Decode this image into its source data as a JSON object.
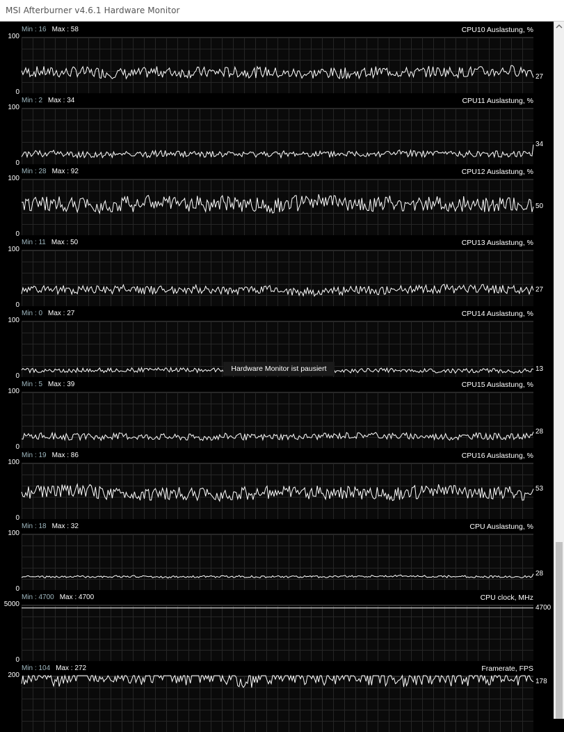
{
  "window": {
    "title": "MSI Afterburner v4.6.1 Hardware Monitor"
  },
  "status": {
    "paused": "Hardware Monitor ist pausiert"
  },
  "colors": {
    "background": "#000000",
    "trace": "#ffffff",
    "grid": "#262626",
    "min_label": "#9fb8c0"
  },
  "graphs": [
    {
      "title": "CPU10 Auslastung, %",
      "min_label": "Min : 16",
      "max_label": "Max : 58",
      "ymax": "100",
      "ymin": "0",
      "current": "27",
      "min": 16,
      "max": 58,
      "avg": 38,
      "noise": 10,
      "last": 27
    },
    {
      "title": "CPU11 Auslastung, %",
      "min_label": "Min : 2",
      "max_label": "Max : 34",
      "ymax": "100",
      "ymin": "0",
      "current": "34",
      "min": 2,
      "max": 34,
      "avg": 17,
      "noise": 6,
      "last": 34
    },
    {
      "title": "CPU12 Auslastung, %",
      "min_label": "Min : 28",
      "max_label": "Max : 92",
      "ymax": "100",
      "ymin": "0",
      "current": "50",
      "min": 28,
      "max": 92,
      "avg": 55,
      "noise": 14,
      "last": 50
    },
    {
      "title": "CPU13 Auslastung, %",
      "min_label": "Min : 11",
      "max_label": "Max : 50",
      "ymax": "100",
      "ymin": "0",
      "current": "27",
      "min": 11,
      "max": 50,
      "avg": 28,
      "noise": 8,
      "last": 27
    },
    {
      "title": "CPU14 Auslastung, %",
      "min_label": "Min : 0",
      "max_label": "Max : 27",
      "ymax": "100",
      "ymin": "0",
      "current": "13",
      "min": 0,
      "max": 27,
      "avg": 11,
      "noise": 4,
      "last": 13
    },
    {
      "title": "CPU15 Auslastung, %",
      "min_label": "Min : 5",
      "max_label": "Max : 39",
      "ymax": "100",
      "ymin": "0",
      "current": "28",
      "min": 5,
      "max": 39,
      "avg": 20,
      "noise": 6,
      "last": 28
    },
    {
      "title": "CPU16 Auslastung, %",
      "min_label": "Min : 19",
      "max_label": "Max : 86",
      "ymax": "100",
      "ymin": "0",
      "current": "53",
      "min": 19,
      "max": 86,
      "avg": 45,
      "noise": 12,
      "last": 53
    },
    {
      "title": "CPU Auslastung, %",
      "min_label": "Min : 18",
      "max_label": "Max : 32",
      "ymax": "100",
      "ymin": "0",
      "current": "28",
      "min": 18,
      "max": 32,
      "avg": 23,
      "noise": 2,
      "last": 28
    },
    {
      "title": "CPU clock, MHz",
      "min_label": "Min : 4700",
      "max_label": "Max : 4700",
      "ymax": "5000",
      "ymin": "0",
      "current": "4700",
      "min": 4700,
      "max": 4700,
      "avg": 4700,
      "noise": 0,
      "last": 4700
    },
    {
      "title": "Framerate, FPS",
      "min_label": "Min : 104",
      "max_label": "Max : 272",
      "ymax": "200",
      "ymin": "",
      "current": "178",
      "min": 104,
      "max": 272,
      "avg": 195,
      "noise": 30,
      "last": 178
    }
  ]
}
